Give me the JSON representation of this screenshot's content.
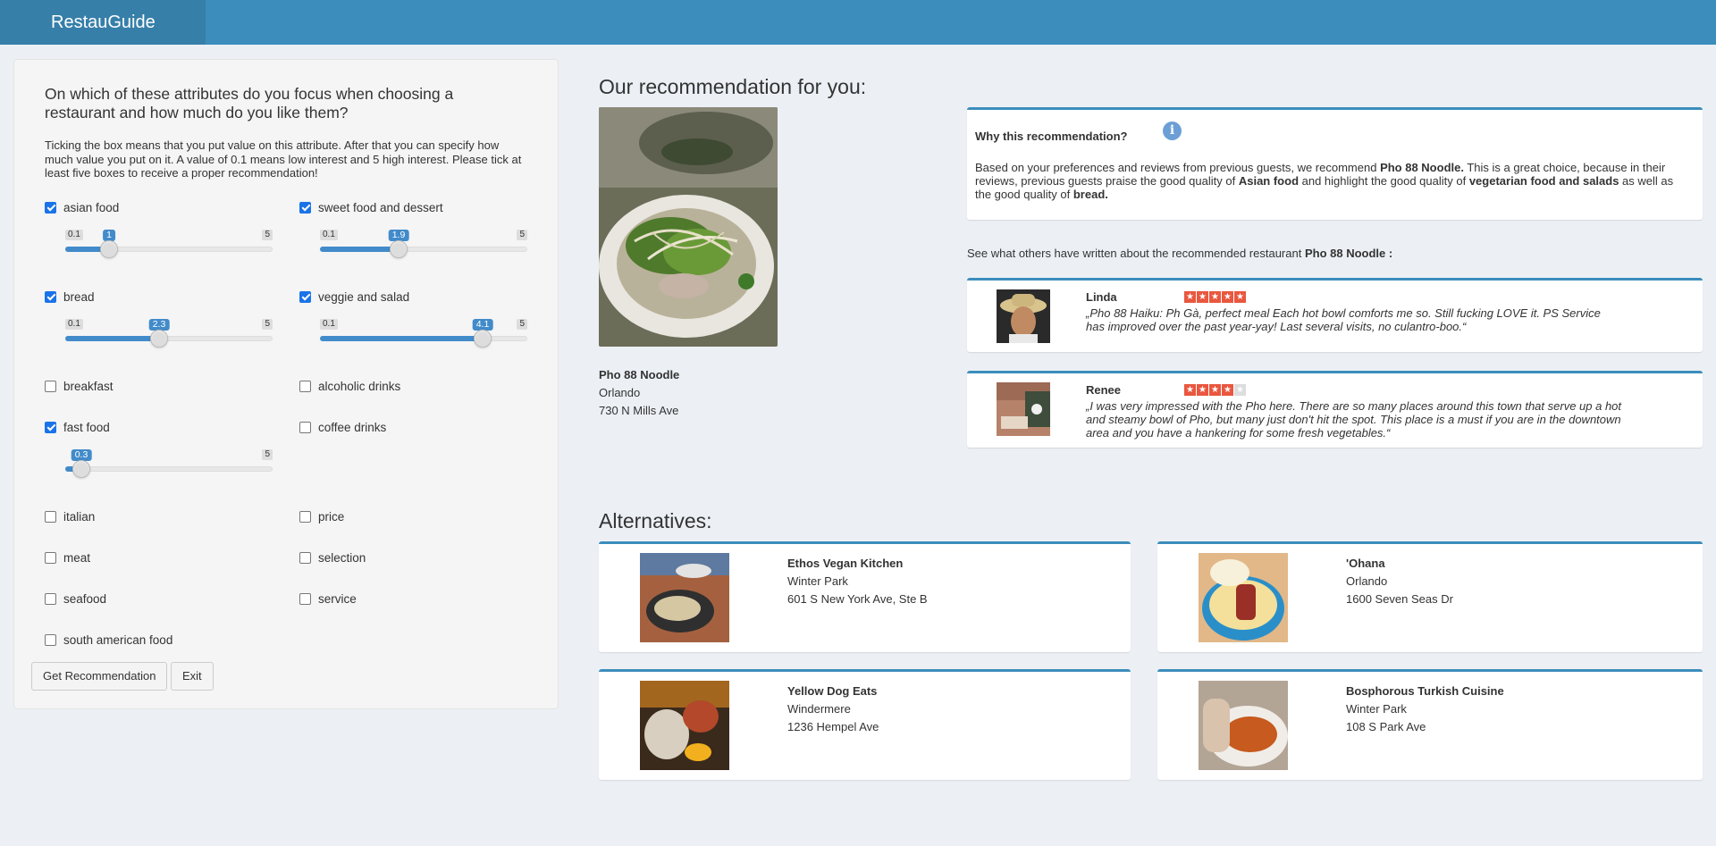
{
  "header": {
    "brand": "RestauGuide"
  },
  "sidebar": {
    "title": "On which of these attributes do you focus when choosing a restaurant and how much do you like them?",
    "description": "Ticking the box means that you put value on this attribute. After that you can specify how much value you put on it. A value of 0.1 means low interest and 5 high interest. Please tick at least five boxes to receive a proper recommendation!",
    "attributes": [
      {
        "label": "asian food",
        "checked": true,
        "slider": {
          "min": "0.1",
          "max": "5",
          "value": "1"
        }
      },
      {
        "label": "sweet food and dessert",
        "checked": true,
        "slider": {
          "min": "0.1",
          "max": "5",
          "value": "1.9"
        }
      },
      {
        "label": "bread",
        "checked": true,
        "slider": {
          "min": "0.1",
          "max": "5",
          "value": "2.3"
        }
      },
      {
        "label": "veggie and salad",
        "checked": true,
        "slider": {
          "min": "0.1",
          "max": "5",
          "value": "4.1"
        }
      },
      {
        "label": "breakfast",
        "checked": false
      },
      {
        "label": "alcoholic drinks",
        "checked": false
      },
      {
        "label": "fast food",
        "checked": true,
        "slider": {
          "min": "0.1",
          "max": "5",
          "value": "0.3"
        }
      },
      {
        "label": "coffee drinks",
        "checked": false
      },
      {
        "label": "italian",
        "checked": false
      },
      {
        "label": "price",
        "checked": false
      },
      {
        "label": "meat",
        "checked": false
      },
      {
        "label": "selection",
        "checked": false
      },
      {
        "label": "seafood",
        "checked": false
      },
      {
        "label": "service",
        "checked": false
      },
      {
        "label": "south american food",
        "checked": false
      }
    ],
    "buttons": {
      "recommend": "Get Recommendation",
      "exit": "Exit"
    }
  },
  "recommendation": {
    "heading": "Our recommendation for you:",
    "name": "Pho 88 Noodle",
    "city": "Orlando",
    "address": "730 N Mills Ave",
    "why_title": "Why this recommendation?",
    "why_text": [
      "Based on your preferences and reviews from previous guests, we recommend ",
      "Pho 88 Noodle.",
      " This is a great choice, because in their reviews, previous guests praise the good quality of ",
      "Asian food",
      " and highlight the good quality of ",
      "vegetarian food and salads",
      " as well as the good quality of ",
      "bread."
    ]
  },
  "reviews_intro": {
    "text": "See what others have written about the recommended restaurant ",
    "name": "Pho 88 Noodle :"
  },
  "reviews": [
    {
      "name": "Linda",
      "rating": 5,
      "text": "„Pho 88 Haiku: Ph Gà, perfect meal Each hot bowl comforts me so. Still fucking LOVE it. PS Service has improved over the past year-yay! Last several visits, no culantro-boo.“"
    },
    {
      "name": "Renee",
      "rating": 4,
      "text": "„I was very impressed with the Pho here. There are so many places around this town that serve up a hot and steamy bowl of Pho, but many just don't hit the spot. This place is a must if you are in the downtown area and you have a hankering for some fresh vegetables.“"
    }
  ],
  "alternatives": {
    "heading": "Alternatives:",
    "items": [
      {
        "name": "Ethos Vegan Kitchen",
        "city": "Winter Park",
        "address": "601 S New York Ave, Ste B"
      },
      {
        "name": "'Ohana",
        "city": "Orlando",
        "address": "1600 Seven Seas Dr"
      },
      {
        "name": "Yellow Dog Eats",
        "city": "Windermere",
        "address": "1236 Hempel Ave"
      },
      {
        "name": "Bosphorous Turkish Cuisine",
        "city": "Winter Park",
        "address": "108 S Park Ave"
      }
    ]
  },
  "colors": {
    "header": "#3c8dbc",
    "brand_bg": "#367fa9",
    "accent": "#428bca",
    "star": "#e9573f"
  }
}
